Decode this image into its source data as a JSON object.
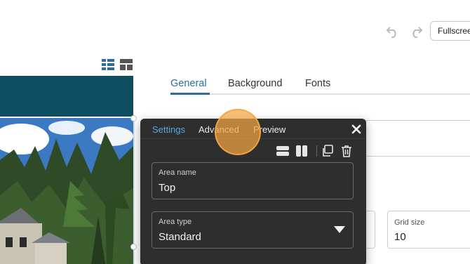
{
  "toolbar": {
    "undo_icon": "undo-icon",
    "redo_icon": "redo-icon",
    "fullscreen_label": "Fullscreen"
  },
  "view_toggle": {
    "list_icon": "list-layout-icon",
    "grid_icon": "grid-layout-icon"
  },
  "preview": {
    "header_color": "#0e4c5f",
    "photo": "house-with-trees-photo"
  },
  "main_tabs": [
    {
      "label": "General",
      "active": true
    },
    {
      "label": "Background",
      "active": false
    },
    {
      "label": "Fonts",
      "active": false
    }
  ],
  "grid_size": {
    "label": "Grid size",
    "value": "10"
  },
  "popup": {
    "tabs": [
      {
        "label": "Settings",
        "active": true
      },
      {
        "label": "Advanced",
        "active": false
      },
      {
        "label": "Preview",
        "active": false
      }
    ],
    "close_icon": "close-icon",
    "tools": [
      "rows-layout-icon",
      "columns-layout-icon",
      "duplicate-icon",
      "trash-icon"
    ],
    "area_name": {
      "label": "Area name",
      "value": "Top"
    },
    "area_type": {
      "label": "Area type",
      "value": "Standard"
    }
  },
  "colors": {
    "accent": "#2f6f97",
    "popup_bg": "#2e2e2e",
    "popup_tab_active": "#5aa9dc",
    "cursor_highlight": "#f4a542"
  }
}
